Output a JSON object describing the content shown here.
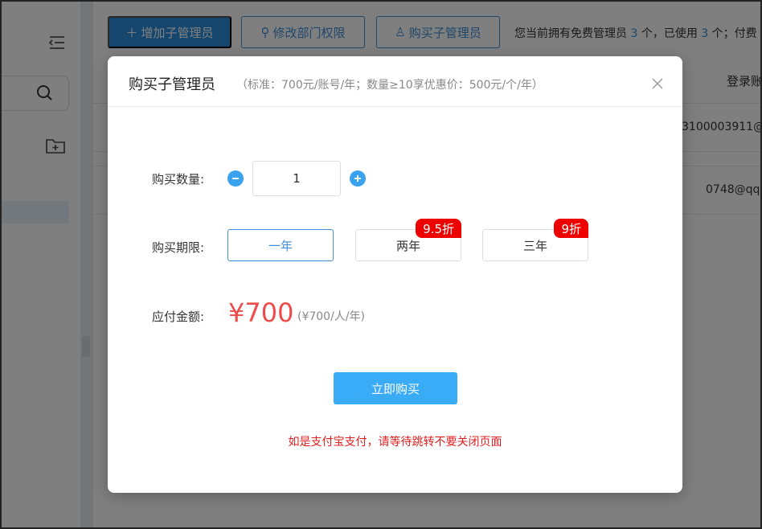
{
  "toolbar": {
    "add_label": "增加子管理员",
    "perm_label": "修改部门权限",
    "buy_label": "购买子管理员",
    "info_prefix": "您当前拥有免费管理员",
    "info_free": "3",
    "info_mid": "个，已使用",
    "info_used": "3",
    "info_suffix": "个；付费"
  },
  "table": {
    "column_header": "登录账",
    "rows": [
      {
        "account": "3100003911@"
      },
      {
        "account": "0748@qq"
      }
    ]
  },
  "modal": {
    "title": "购买子管理员",
    "subtitle": "（标准：700元/账号/年；数量≥10享优惠价：500元/个/年）",
    "quantity_label": "购买数量:",
    "quantity_value": "1",
    "period_label": "购买期限:",
    "periods": [
      {
        "label": "一年",
        "badge": "",
        "selected": true
      },
      {
        "label": "两年",
        "badge": "9.5折",
        "selected": false
      },
      {
        "label": "三年",
        "badge": "9折",
        "selected": false
      }
    ],
    "amount_label": "应付金额:",
    "amount": "¥700",
    "amount_unit": "(¥700/人/年)",
    "buy_button": "立即购买",
    "notice": "如是支付宝支付，请等待跳转不要关闭页面"
  },
  "colors": {
    "accent": "#3aabf7",
    "price": "#ee4b4b",
    "badge": "#e00000",
    "notice": "#e02020"
  }
}
